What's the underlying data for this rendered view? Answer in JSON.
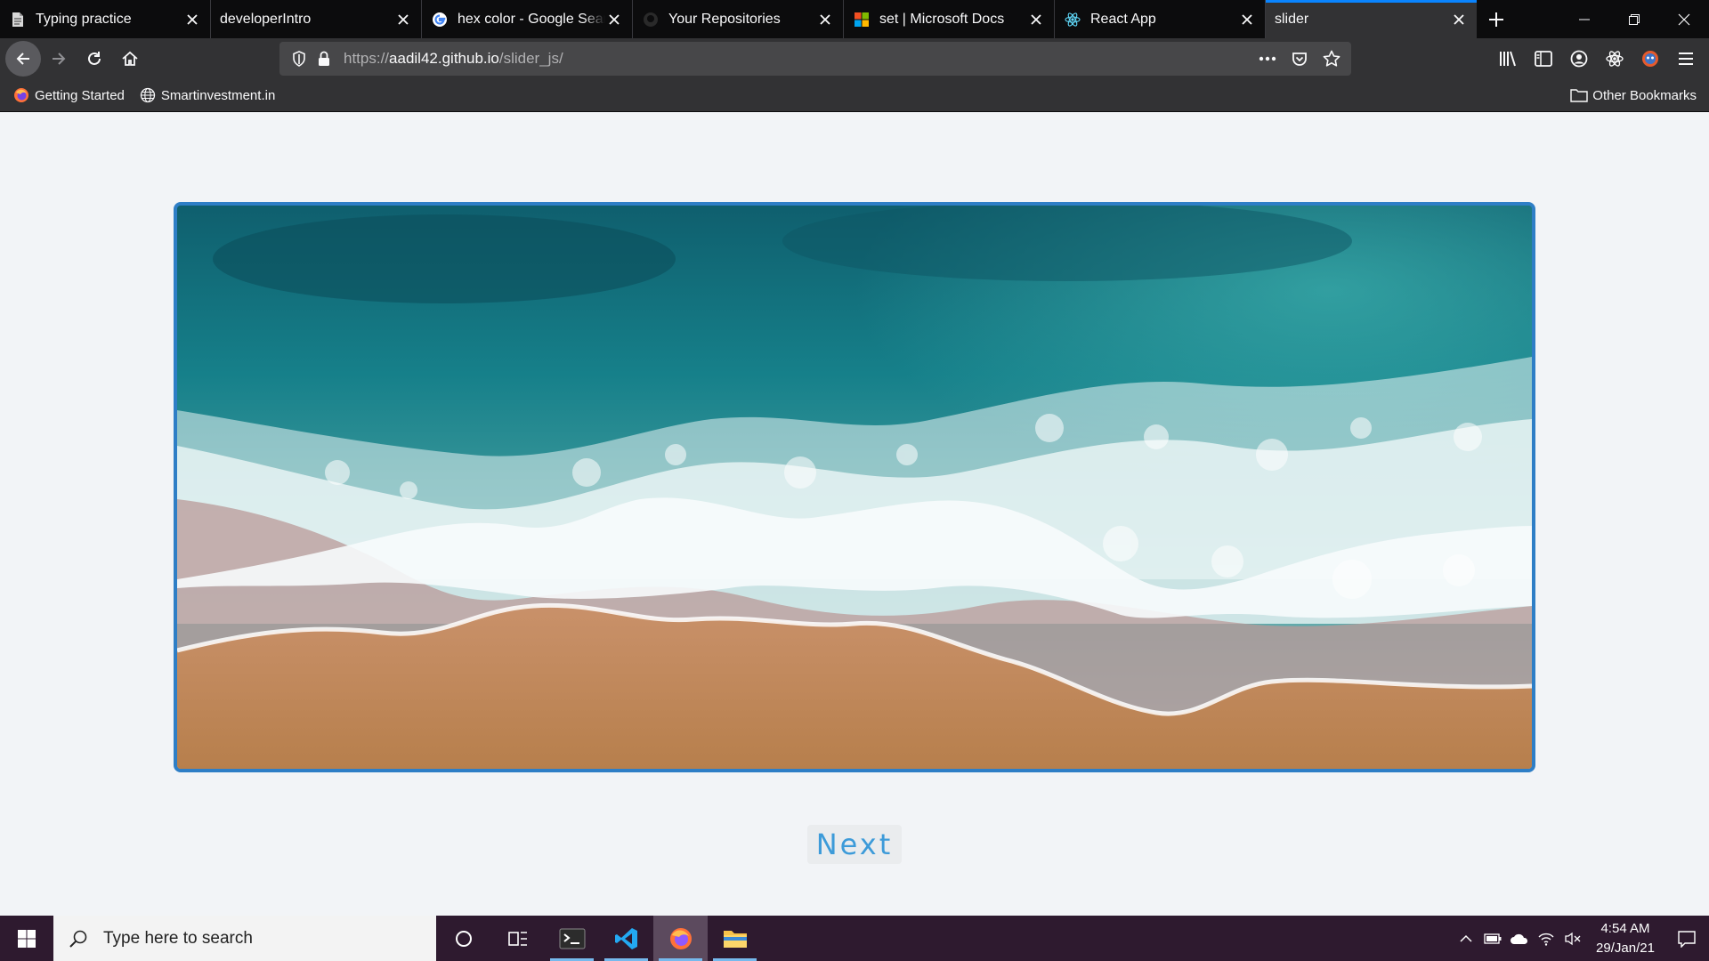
{
  "tabs": [
    {
      "title": "Typing practice",
      "icon": "document-icon",
      "active": false
    },
    {
      "title": "developerIntro",
      "icon": "",
      "active": false
    },
    {
      "title": "hex color - Google Search",
      "icon": "google-icon",
      "active": false
    },
    {
      "title": "Your Repositories",
      "icon": "github-icon",
      "active": false
    },
    {
      "title": "set | Microsoft Docs",
      "icon": "microsoft-icon",
      "active": false
    },
    {
      "title": "React App",
      "icon": "react-icon",
      "active": false
    },
    {
      "title": "slider",
      "icon": "",
      "active": true
    }
  ],
  "urlbar": {
    "scheme": "https://",
    "host": "aadil42.github.io",
    "path": "/slider_js/"
  },
  "bookmarks": {
    "items": [
      {
        "label": "Getting Started",
        "icon": "firefox-icon"
      },
      {
        "label": "Smartinvestment.in",
        "icon": "globe-icon"
      }
    ],
    "other": "Other Bookmarks"
  },
  "page": {
    "slide_image": "ocean-waves-beach-aerial-photo",
    "next_label": "Next"
  },
  "taskbar": {
    "search_placeholder": "Type here to search",
    "time": "4:54 AM",
    "date": "29/Jan/21"
  },
  "colors": {
    "accent": "#0a84ff",
    "slider_border": "#2e7ec6",
    "next_text": "#3d9bd9",
    "taskbar": "#2e1a2f"
  }
}
